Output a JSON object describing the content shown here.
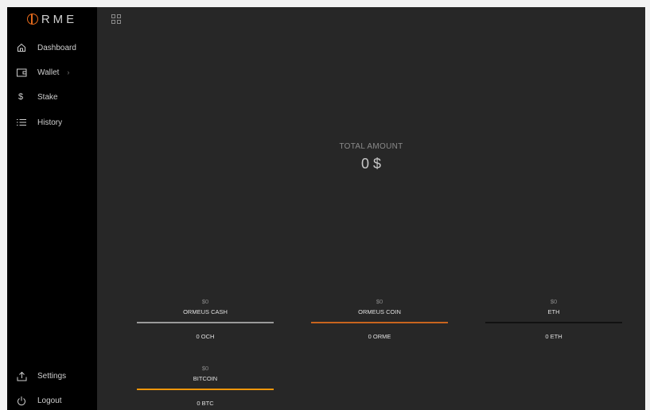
{
  "logo": {
    "text": "RME"
  },
  "sidebar": {
    "items": [
      {
        "label": "Dashboard",
        "icon": "home-icon"
      },
      {
        "label": "Wallet",
        "icon": "wallet-icon",
        "chevron": "›"
      },
      {
        "label": "Stake",
        "icon": "dollar-icon",
        "glyph": "$"
      },
      {
        "label": "History",
        "icon": "list-icon"
      },
      {
        "label": "Settings",
        "icon": "upload-icon"
      },
      {
        "label": "Logout",
        "icon": "power-icon"
      }
    ]
  },
  "total": {
    "label": "TOTAL AMOUNT",
    "value": "0 $"
  },
  "cards": [
    {
      "usd": "$0",
      "name": "ORMEUS CASH",
      "amount": "0 OCH",
      "color": "#9a9a9a"
    },
    {
      "usd": "$0",
      "name": "ORMEUS COIN",
      "amount": "0 ORME",
      "color": "#c8641e"
    },
    {
      "usd": "$0",
      "name": "ETH",
      "amount": "0 ETH",
      "color": "#111111"
    },
    {
      "usd": "$0",
      "name": "BITCOIN",
      "amount": "0 BTC",
      "color": "#f0960a"
    }
  ]
}
